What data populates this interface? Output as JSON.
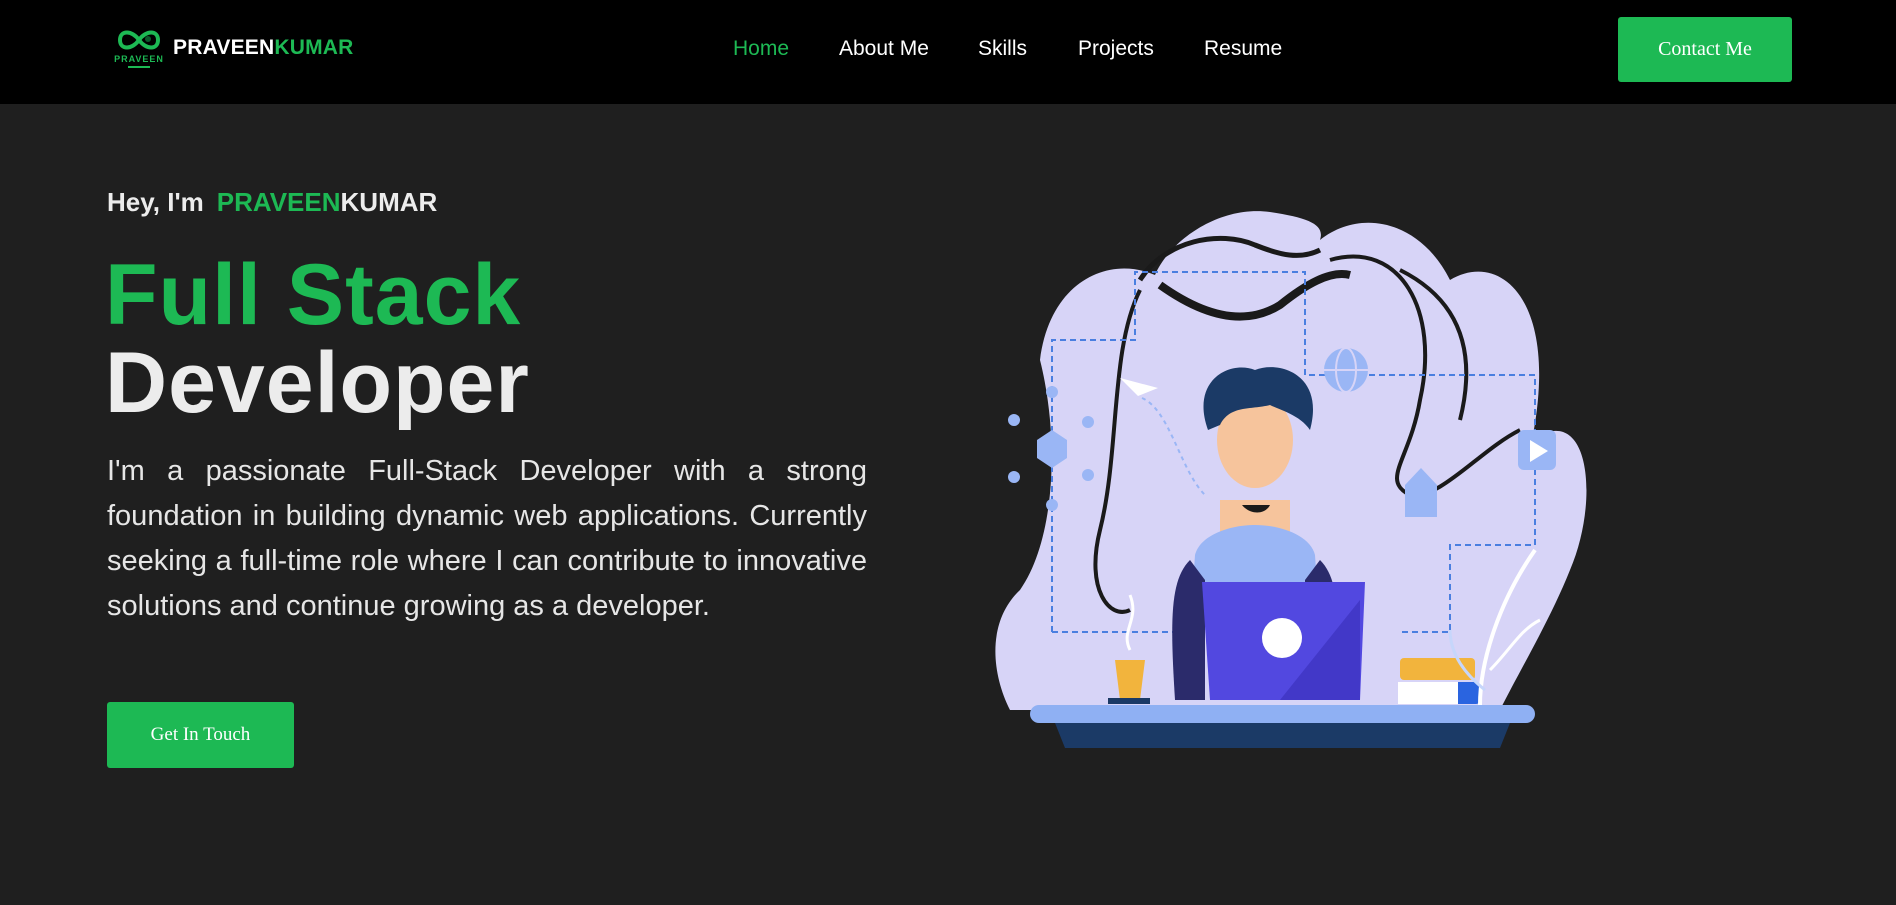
{
  "header": {
    "logo_text": "PRAVEEN",
    "brand_first": "PRAVEEN",
    "brand_second": "KUMAR",
    "nav": [
      {
        "label": "Home",
        "active": true
      },
      {
        "label": "About Me"
      },
      {
        "label": "Skills"
      },
      {
        "label": "Projects"
      },
      {
        "label": "Resume"
      }
    ],
    "contact_label": "Contact Me"
  },
  "hero": {
    "greeting_prefix": "Hey, I'm",
    "name_first": "PRAVEEN",
    "name_second": "KUMAR",
    "title_line1": "Full Stack",
    "title_line2": "Developer",
    "description": "I'm a passionate Full-Stack Developer with a strong foundation in building dynamic web applications. Currently seeking a full-time role where I can contribute to innovative solutions and continue growing as a developer.",
    "cta_label": "Get In Touch"
  },
  "colors": {
    "accent": "#1db954",
    "background": "#1f1f1f",
    "navbar": "#000000",
    "illustration_blob": "#d7d4f7",
    "laptop": "#5248e0"
  },
  "icons": [
    "infinity-logo-icon",
    "developer-illustration"
  ]
}
